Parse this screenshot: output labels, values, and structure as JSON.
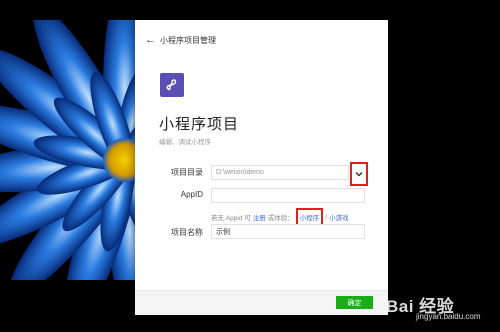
{
  "dialog": {
    "back_title": "小程序项目管理",
    "title": "小程序项目",
    "subtitle": "编辑、调试小程序"
  },
  "form": {
    "directory_label": "项目目录",
    "directory_placeholder": "D:\\weixin\\demo",
    "appid_label": "AppID",
    "appid_value": "",
    "hint_prefix": "若无 Appid 可",
    "hint_register": "注册",
    "hint_or_try": "或体验：",
    "hint_miniprogram": "小程序",
    "hint_separator": "/",
    "hint_minigame": "小游戏",
    "name_label": "项目名称",
    "name_value": "示例"
  },
  "footer": {
    "confirm_label": "确定"
  },
  "watermark": {
    "line1": "Bai 经验",
    "line2": "jingyan.baidu.com"
  },
  "colors": {
    "logo": "#5b4fb5",
    "confirm": "#1aad19",
    "link": "#3a6ad8",
    "highlight": "#e02020"
  }
}
